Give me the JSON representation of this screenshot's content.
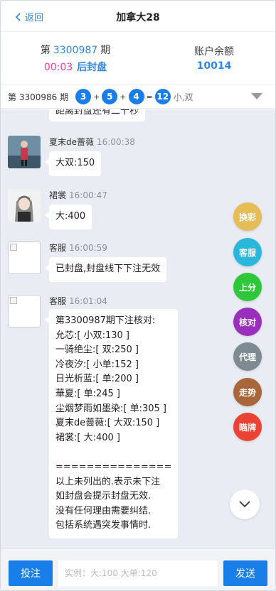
{
  "header": {
    "back_label": "返回",
    "title": "加拿大28"
  },
  "info": {
    "period_prefix": "第",
    "period_number": "3300987",
    "period_suffix": "期",
    "countdown": "00:03",
    "status": "后封盘",
    "balance_label": "账户余额",
    "balance_value": "10014"
  },
  "last_result": {
    "label": "第 3300986 期",
    "balls": [
      "3",
      "5",
      "4"
    ],
    "sum": "12",
    "desc": "小,双"
  },
  "messages": [
    {
      "bubble_lines": [
        "距离封盘还有二十秒"
      ]
    },
    {
      "name": "夏末de蔷薇",
      "time": "16:00:38",
      "bubble_lines": [
        "大双:150"
      ]
    },
    {
      "name": "裙裳",
      "time": "16:00:47",
      "bubble_lines": [
        "大:400"
      ]
    },
    {
      "name": "客服",
      "time": "16:00:59",
      "bubble_lines": [
        "已封盘,封盘线下下注无效"
      ]
    },
    {
      "name": "客服",
      "time": "16:01:04",
      "bubble_lines": [
        "第3300987期下注核对:",
        "允芯:[ 小双:130 ]",
        "一骑绝尘:[ 双:250 ]",
        "冷夜汐:[ 小单:152 ]",
        "日光析蓝:[ 单:200 ]",
        "華夏:[ 单:245 ]",
        "尘烟梦雨如墨染:[ 单:305 ]",
        "夏末de蔷薇:[ 大双:150 ]",
        "裙裳:[ 大:400 ]",
        "",
        "===============",
        "以上未列出的.表示未下注",
        "如封盘会提示封盘无效.",
        "没有任何理由需要纠结.",
        "包括系统遇突发事情时."
      ]
    }
  ],
  "side_buttons": [
    {
      "label": "换彩",
      "color": "#e5bc55"
    },
    {
      "label": "客服",
      "color": "#29b8dc"
    },
    {
      "label": "上分",
      "color": "#2ec73a"
    },
    {
      "label": "核对",
      "color": "#9b2fbd"
    },
    {
      "label": "代理",
      "color": "#7d8a92"
    },
    {
      "label": "走势",
      "color": "#a8663a"
    },
    {
      "label": "瞄牌",
      "color": "#ea4335"
    }
  ],
  "bottom": {
    "bet_label": "投注",
    "input_placeholder": "实例：大:100 大单:120",
    "send_label": "发送"
  },
  "colors": {
    "accent": "#1a7ee8",
    "countdown": "#e73da2",
    "chat_bg": "#e9ecf3"
  }
}
